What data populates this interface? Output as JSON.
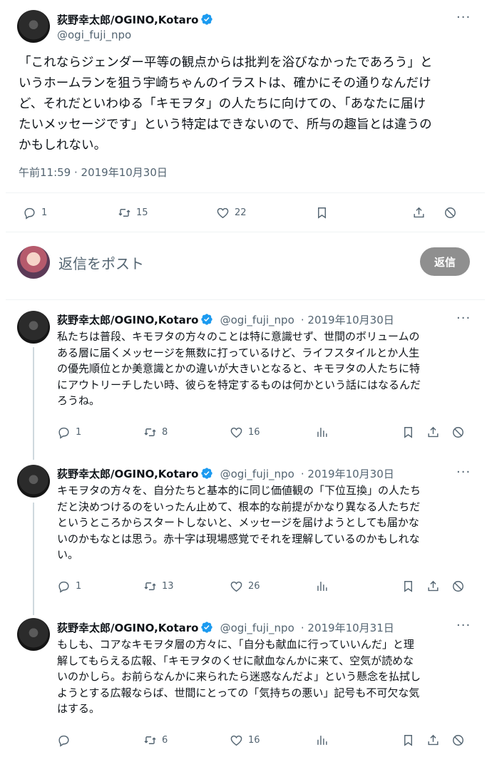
{
  "main_tweet": {
    "author_name": "荻野幸太郎/OGINO,Kotaro",
    "handle": "@ogi_fuji_npo",
    "text_lines": [
      "「これならジェンダー平等の観点からは批判を浴びなかったであろう」と",
      "いうホームランを狙う宇崎ちゃんのイラストは、確かにその通りなんだけ",
      "ど、それだといわゆる「キモヲタ」の人たちに向けての、「あなたに届け",
      "たいメッセージです」という特定はできないので、所与の趣旨とは違うの",
      "かもしれない。"
    ],
    "timestamp": "午前11:59 · 2019年10月30日",
    "replies": "1",
    "retweets": "15",
    "likes": "22",
    "more": "···"
  },
  "reply_box": {
    "placeholder": "返信をポスト",
    "button_label": "返信"
  },
  "replies": [
    {
      "author_name": "荻野幸太郎/OGINO,Kotaro",
      "handle": "@ogi_fuji_npo",
      "date": "· 2019年10月30日",
      "text_lines": [
        "私たちは普段、キモヲタの方々のことは特に意識せず、世間のボリュームの",
        "ある層に届くメッセージを無数に打っているけど、ライフスタイルとか人生",
        "の優先順位とか美意識とかの違いが大きいとなると、キモヲタの人たちに特",
        "にアウトリーチしたい時、彼らを特定するものは何かという話にはなるんだ",
        "ろうね。"
      ],
      "replies": "1",
      "retweets": "8",
      "likes": "16",
      "more": "···"
    },
    {
      "author_name": "荻野幸太郎/OGINO,Kotaro",
      "handle": "@ogi_fuji_npo",
      "date": "· 2019年10月30日",
      "text_lines": [
        "キモヲタの方々を、自分たちと基本的に同じ価値観の「下位互換」の人たち",
        "だと決めつけるのをいったん止めて、根本的な前提がかなり異なる人たちだ",
        "というところからスタートしないと、メッセージを届けようとしても届かな",
        "いのかもなとは思う。赤十字は現場感覚でそれを理解しているのかもしれな",
        "い。"
      ],
      "replies": "1",
      "retweets": "13",
      "likes": "26",
      "more": "···"
    },
    {
      "author_name": "荻野幸太郎/OGINO,Kotaro",
      "handle": "@ogi_fuji_npo",
      "date": "· 2019年10月31日",
      "text_lines": [
        "もしも、コアなキモヲタ層の方々に、「自分も献血に行っていいんだ」と理",
        "解してもらえる広報、「キモヲタのくせに献血なんかに来て、空気が読めな",
        "いのかしら。お前らなんかに来られたら迷惑なんだよ」という懸念を払拭し",
        "ようとする広報ならば、世間にとっての「気持ちの悪い」記号も不可欠な気",
        "はする。"
      ],
      "replies": "",
      "retweets": "6",
      "likes": "16",
      "more": "···"
    }
  ],
  "colors": {
    "verified": "#1d9bf0",
    "text": "#0f1419",
    "secondary": "#536471",
    "divider": "#eff3f4",
    "reply_button": "#8f8f8f"
  }
}
